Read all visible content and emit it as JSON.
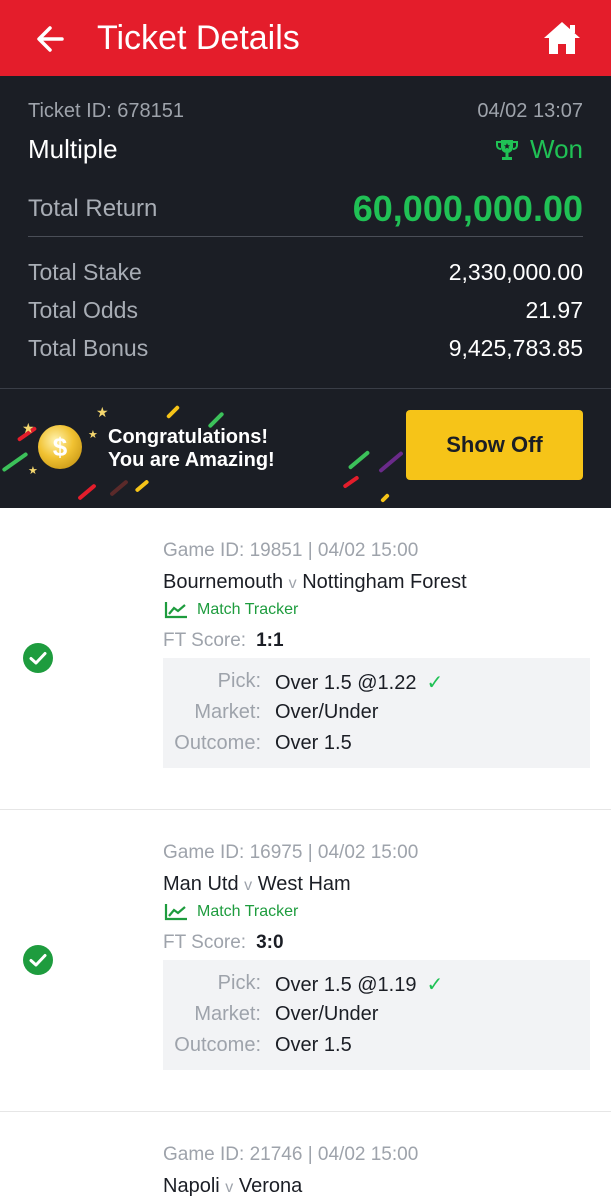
{
  "header": {
    "title": "Ticket Details",
    "back_icon": "arrow-left-icon",
    "home_icon": "home-icon",
    "background": "#e41d2b"
  },
  "ticket": {
    "id_label": "Ticket ID: 678151",
    "date": "04/02 13:07",
    "type": "Multiple",
    "status": "Won",
    "total_return_label": "Total Return",
    "total_return": "60,000,000.00",
    "rows": [
      {
        "label": "Total Stake",
        "value": "2,330,000.00"
      },
      {
        "label": "Total Odds",
        "value": "21.97"
      },
      {
        "label": "Total Bonus",
        "value": "9,425,783.85"
      }
    ]
  },
  "banner": {
    "line1": "Congratulations!",
    "line2": "You are Amazing!",
    "button": "Show Off",
    "coin_symbol": "$"
  },
  "games": [
    {
      "id_line": "Game ID: 19851 | 04/02 15:00",
      "home": "Bournemouth",
      "vs": "v",
      "away": "Nottingham Forest",
      "tracker": "Match Tracker",
      "ft_label": "FT Score:",
      "ft_score": "1:1",
      "pick_label": "Pick:",
      "pick": "Over 1.5 @1.22",
      "market_label": "Market:",
      "market": "Over/Under",
      "outcome_label": "Outcome:",
      "outcome": "Over 1.5"
    },
    {
      "id_line": "Game ID: 16975 | 04/02 15:00",
      "home": "Man Utd",
      "vs": "v",
      "away": "West Ham",
      "tracker": "Match Tracker",
      "ft_label": "FT Score:",
      "ft_score": "3:0",
      "pick_label": "Pick:",
      "pick": "Over 1.5 @1.19",
      "market_label": "Market:",
      "market": "Over/Under",
      "outcome_label": "Outcome:",
      "outcome": "Over 1.5"
    },
    {
      "id_line": "Game ID: 21746 | 04/02 15:00",
      "home": "Napoli",
      "vs": "v",
      "away": "Verona"
    }
  ],
  "colors": {
    "accent_green": "#20c155",
    "dark_panel": "#1b1e25",
    "button_yellow": "#f6c418"
  }
}
